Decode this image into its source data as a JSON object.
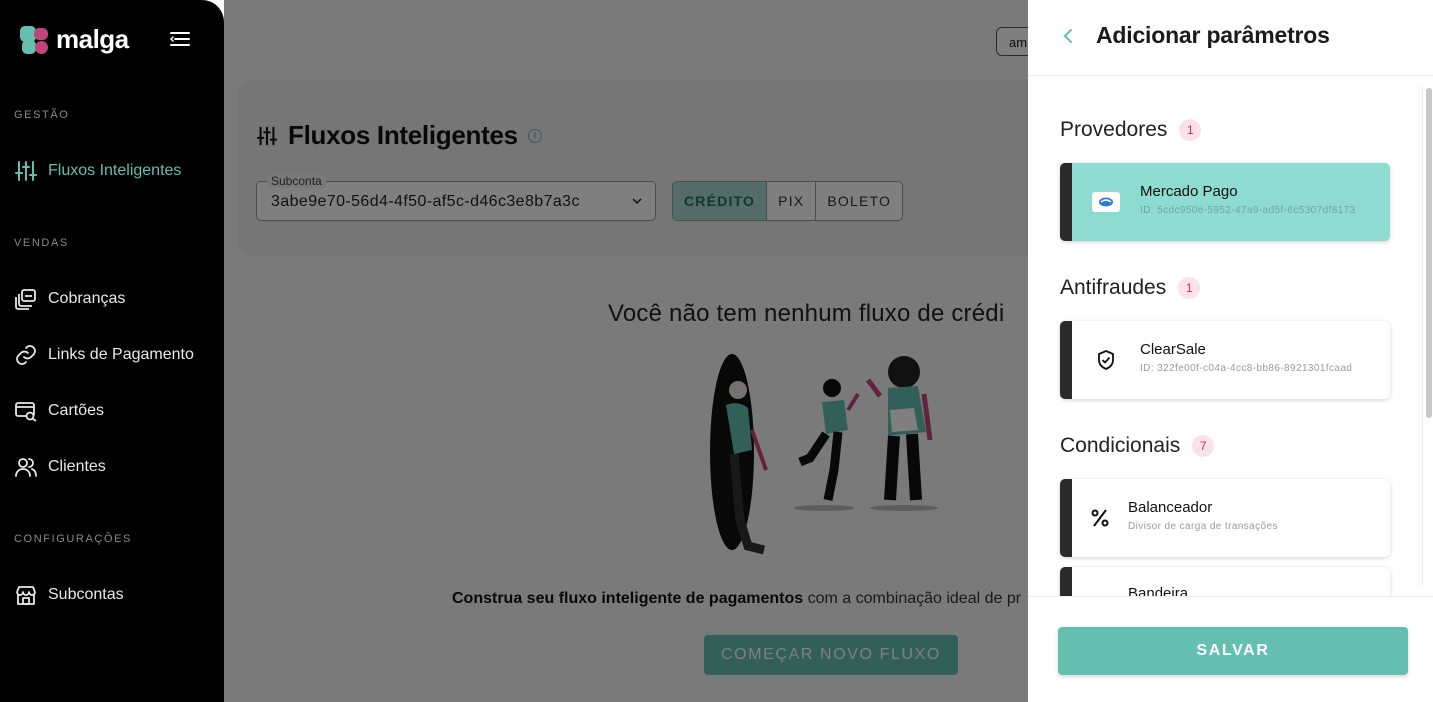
{
  "app": {
    "logo_text": "malga"
  },
  "sidebar": {
    "sections": [
      {
        "label": "GESTÃO"
      },
      {
        "label": "VENDAS"
      },
      {
        "label": "CONFIGURAÇÕES"
      }
    ],
    "items": [
      {
        "label": "Fluxos Inteligentes",
        "icon": "sliders-icon",
        "active": true
      },
      {
        "label": "Cobranças",
        "icon": "charges-icon"
      },
      {
        "label": "Links de Pagamento",
        "icon": "link-icon"
      },
      {
        "label": "Cartões",
        "icon": "card-search-icon"
      },
      {
        "label": "Clientes",
        "icon": "users-icon"
      },
      {
        "label": "Subcontas",
        "icon": "store-icon"
      }
    ]
  },
  "main": {
    "account_badge": "am",
    "title": "Fluxos Inteligentes",
    "subconta": {
      "label": "Subconta",
      "value": "3abe9e70-56d4-4f50-af5c-d46c3e8b7a3c"
    },
    "payment_tabs": [
      {
        "label": "CRÉDITO",
        "active": true
      },
      {
        "label": "PIX"
      },
      {
        "label": "BOLETO"
      }
    ],
    "empty_heading": "Você não tem nenhum fluxo de crédi",
    "empty_text_bold": "Construa seu fluxo inteligente de pagamentos",
    "empty_text_rest": " com a combinação ideal de pr",
    "start_button": "COMEÇAR NOVO FLUXO"
  },
  "drawer": {
    "title": "Adicionar parâmetros",
    "groups": {
      "provedores": {
        "title": "Provedores",
        "count": "1",
        "items": [
          {
            "name": "Mercado Pago",
            "sub": "ID: 5cdc950e-5952-47a9-ad5f-6c5307df8173",
            "selected": true
          }
        ]
      },
      "antifraudes": {
        "title": "Antifraudes",
        "count": "1",
        "items": [
          {
            "name": "ClearSale",
            "sub": "ID: 322fe00f-c04a-4cc8-bb86-8921301fcaad"
          }
        ]
      },
      "condicionais": {
        "title": "Condicionais",
        "count": "7",
        "items": [
          {
            "name": "Balanceador",
            "sub": "Divisor de carga de transações"
          },
          {
            "name": "Bandeira",
            "sub": ""
          }
        ]
      }
    },
    "save_button": "SALVAR"
  },
  "colors": {
    "accent": "#65bfb1",
    "selected_card": "#8edcd1",
    "badge_bg": "#fbe1ea",
    "badge_text": "#c0325f"
  }
}
